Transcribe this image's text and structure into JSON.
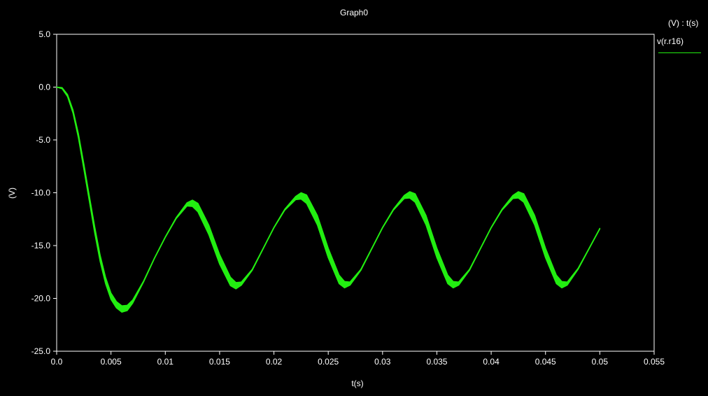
{
  "chart_data": {
    "type": "line",
    "title": "Graph0",
    "xlabel": "t(s)",
    "ylabel": "(V)",
    "xlim": [
      0,
      0.055
    ],
    "ylim": [
      -25,
      5
    ],
    "x_ticks": [
      "0.0",
      "0.005",
      "0.01",
      "0.015",
      "0.02",
      "0.025",
      "0.03",
      "0.035",
      "0.04",
      "0.045",
      "0.05",
      "0.055"
    ],
    "y_ticks": [
      "5.0",
      "0.0",
      "-5.0",
      "-10.0",
      "-15.0",
      "-20.0",
      "-25.0"
    ],
    "grid": false,
    "legend": {
      "header": "(V) : t(s)",
      "placement": "top-right"
    },
    "series": [
      {
        "name": "v(r.r16)",
        "color": "#22ee11",
        "x": [
          0,
          0.0005,
          0.001,
          0.0015,
          0.002,
          0.0025,
          0.003,
          0.0035,
          0.004,
          0.0045,
          0.005,
          0.0055,
          0.006,
          0.0065,
          0.007,
          0.008,
          0.009,
          0.01,
          0.011,
          0.012,
          0.0125,
          0.013,
          0.014,
          0.015,
          0.016,
          0.0165,
          0.017,
          0.018,
          0.019,
          0.02,
          0.021,
          0.022,
          0.0225,
          0.023,
          0.024,
          0.025,
          0.026,
          0.0265,
          0.027,
          0.028,
          0.029,
          0.03,
          0.031,
          0.032,
          0.0325,
          0.033,
          0.034,
          0.035,
          0.036,
          0.0365,
          0.037,
          0.038,
          0.039,
          0.04,
          0.041,
          0.042,
          0.0425,
          0.043,
          0.044,
          0.045,
          0.046,
          0.0465,
          0.047,
          0.048,
          0.049,
          0.05
        ],
        "y": [
          0,
          -0.1,
          -0.8,
          -2.3,
          -4.6,
          -7.5,
          -10.5,
          -13.5,
          -16.2,
          -18.3,
          -19.8,
          -20.6,
          -21.0,
          -20.9,
          -20.3,
          -18.4,
          -16.2,
          -14.2,
          -12.4,
          -11.1,
          -11.0,
          -11.4,
          -13.5,
          -16.3,
          -18.4,
          -18.8,
          -18.6,
          -17.3,
          -15.3,
          -13.3,
          -11.6,
          -10.5,
          -10.3,
          -10.6,
          -12.6,
          -15.7,
          -18.2,
          -18.7,
          -18.6,
          -17.3,
          -15.3,
          -13.3,
          -11.6,
          -10.4,
          -10.2,
          -10.5,
          -12.6,
          -15.7,
          -18.2,
          -18.7,
          -18.6,
          -17.3,
          -15.3,
          -13.3,
          -11.6,
          -10.4,
          -10.2,
          -10.5,
          -12.6,
          -15.7,
          -18.2,
          -18.7,
          -18.6,
          -17.2,
          -15.3,
          -13.4
        ],
        "band_halfwidth": [
          0,
          0.05,
          0.1,
          0.15,
          0.2,
          0.25,
          0.25,
          0.3,
          0.3,
          0.3,
          0.3,
          0.3,
          0.3,
          0.25,
          0.15,
          0.05,
          0.03,
          0.03,
          0.05,
          0.15,
          0.3,
          0.4,
          0.45,
          0.45,
          0.4,
          0.3,
          0.15,
          0.05,
          0.03,
          0.03,
          0.05,
          0.15,
          0.3,
          0.4,
          0.45,
          0.45,
          0.4,
          0.3,
          0.15,
          0.05,
          0.03,
          0.03,
          0.05,
          0.15,
          0.3,
          0.4,
          0.45,
          0.45,
          0.4,
          0.3,
          0.15,
          0.05,
          0.03,
          0.03,
          0.05,
          0.15,
          0.3,
          0.4,
          0.45,
          0.45,
          0.4,
          0.3,
          0.15,
          0.05,
          0.03,
          0.03
        ]
      }
    ]
  }
}
